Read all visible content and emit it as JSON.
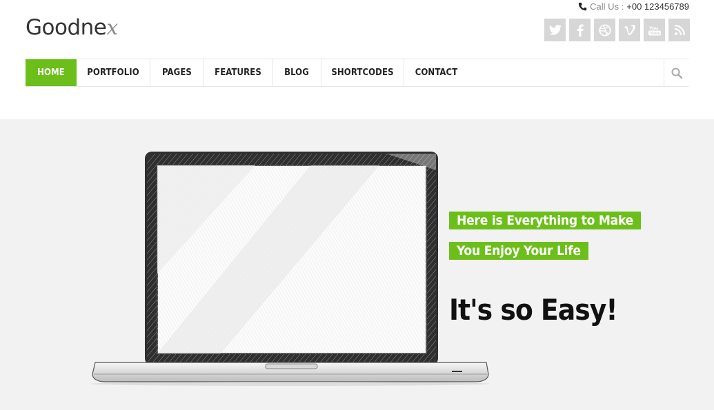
{
  "header": {
    "call_label": "Call Us :",
    "phone": "+00 123456789",
    "logo_text": "Goodne",
    "logo_mark": "x",
    "social": [
      {
        "icon": "twitter-icon",
        "glyph": "🐦"
      },
      {
        "icon": "facebook-icon",
        "glyph": "f"
      },
      {
        "icon": "dribbble-icon",
        "glyph": "◍"
      },
      {
        "icon": "vimeo-icon",
        "glyph": "v"
      },
      {
        "icon": "youtube-icon",
        "glyph": "You"
      },
      {
        "icon": "rss-icon",
        "glyph": "◔"
      }
    ]
  },
  "nav": {
    "items": [
      {
        "label": "HOME",
        "active": true
      },
      {
        "label": "PORTFOLIO",
        "active": false
      },
      {
        "label": "PAGES",
        "active": false
      },
      {
        "label": "FEATURES",
        "active": false
      },
      {
        "label": "BLOG",
        "active": false
      },
      {
        "label": "SHORTCODES",
        "active": false
      },
      {
        "label": "CONTACT",
        "active": false
      }
    ],
    "search_icon": "search-icon"
  },
  "hero": {
    "tag_line_1": "Here is Everything to Make",
    "tag_line_2": "You Enjoy Your Life",
    "headline": "It's so Easy!"
  },
  "colors": {
    "accent": "#6cbf1a",
    "hero_bg": "#f2f2f2",
    "social_bg": "#d7d7d7"
  }
}
